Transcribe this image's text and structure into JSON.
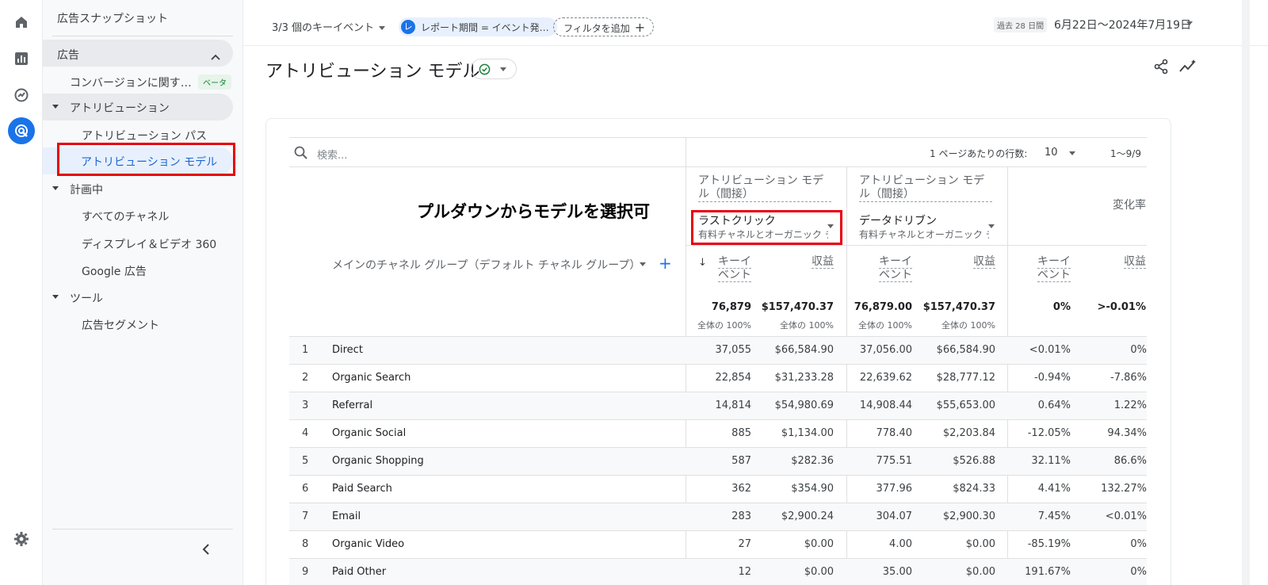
{
  "rail": {
    "icons": [
      "home-icon",
      "reports-icon",
      "explore-icon",
      "advertising-icon",
      "settings-icon"
    ]
  },
  "sidebar": {
    "title": "広告スナップショット",
    "section": "広告",
    "conversion_item": "コンバージョンに関す…",
    "beta": "ベータ",
    "attribution_group": "アトリビューション",
    "attribution_paths": "アトリビューション パス",
    "attribution_models": "アトリビューション モデル",
    "planning_group": "計画中",
    "all_channels": "すべてのチャネル",
    "display_video": "ディスプレイ＆ビデオ 360",
    "google_ads": "Google 広告",
    "tools_group": "ツール",
    "ad_segments": "広告セグメント"
  },
  "topbar": {
    "key_events": "3/3 個のキーイベント",
    "chip_letter": "レ",
    "chip_label": "レポート期間 = イベント発…",
    "add_filter": "フィルタを追加",
    "period_tag": "過去 28 日間",
    "period_date": "6月22日～2024年7月19日"
  },
  "page": {
    "title": "アトリビューション モデル"
  },
  "table": {
    "search_placeholder": "検索...",
    "rows_per_page_label": "1 ページあたりの行数:",
    "rows_per_page_value": "10",
    "range": "1～9/9",
    "annotation": "プルダウンからモデルを選択可",
    "model1_header": "アトリビューション モデル（間接）",
    "model1_selected": "ラストクリック",
    "model1_sub": "有料チャネルとオーガニック チャネル",
    "model2_header": "アトリビューション モデル（間接）",
    "model2_selected": "データドリブン",
    "model2_sub": "有料チャネルとオーガニック チャネル",
    "change_header": "変化率",
    "dimension_header": "メインのチャネル グループ（デフォルト チャネル グループ）",
    "col_key_events": "キーイベント",
    "col_revenue": "収益",
    "totals": {
      "m1_events": "76,879",
      "m1_revenue": "$157,470.37",
      "m2_events": "76,879.00",
      "m2_revenue": "$157,470.37",
      "ch_events": "0%",
      "ch_revenue": ">-0.01%",
      "share": "全体の 100%"
    },
    "rows": [
      {
        "idx": "1",
        "name": "Direct",
        "m1e": "37,055",
        "m1r": "$66,584.90",
        "m2e": "37,056.00",
        "m2r": "$66,584.90",
        "che": "<0.01%",
        "chr": "0%"
      },
      {
        "idx": "2",
        "name": "Organic Search",
        "m1e": "22,854",
        "m1r": "$31,233.28",
        "m2e": "22,639.62",
        "m2r": "$28,777.12",
        "che": "-0.94%",
        "chr": "-7.86%"
      },
      {
        "idx": "3",
        "name": "Referral",
        "m1e": "14,814",
        "m1r": "$54,980.69",
        "m2e": "14,908.44",
        "m2r": "$55,653.00",
        "che": "0.64%",
        "chr": "1.22%"
      },
      {
        "idx": "4",
        "name": "Organic Social",
        "m1e": "885",
        "m1r": "$1,134.00",
        "m2e": "778.40",
        "m2r": "$2,203.84",
        "che": "-12.05%",
        "chr": "94.34%"
      },
      {
        "idx": "5",
        "name": "Organic Shopping",
        "m1e": "587",
        "m1r": "$282.36",
        "m2e": "775.51",
        "m2r": "$526.88",
        "che": "32.11%",
        "chr": "86.6%"
      },
      {
        "idx": "6",
        "name": "Paid Search",
        "m1e": "362",
        "m1r": "$354.90",
        "m2e": "377.96",
        "m2r": "$824.33",
        "che": "4.41%",
        "chr": "132.27%"
      },
      {
        "idx": "7",
        "name": "Email",
        "m1e": "283",
        "m1r": "$2,900.24",
        "m2e": "304.07",
        "m2r": "$2,900.30",
        "che": "7.45%",
        "chr": "<0.01%"
      },
      {
        "idx": "8",
        "name": "Organic Video",
        "m1e": "27",
        "m1r": "$0.00",
        "m2e": "4.00",
        "m2r": "$0.00",
        "che": "-85.19%",
        "chr": "0%"
      },
      {
        "idx": "9",
        "name": "Paid Other",
        "m1e": "12",
        "m1r": "$0.00",
        "m2e": "35.00",
        "m2r": "$0.00",
        "che": "191.67%",
        "chr": "0%"
      }
    ]
  },
  "colors": {
    "accent": "#1a73e8",
    "highlight_box": "#e8000b",
    "active_nav_bg": "#e8f0fe"
  }
}
